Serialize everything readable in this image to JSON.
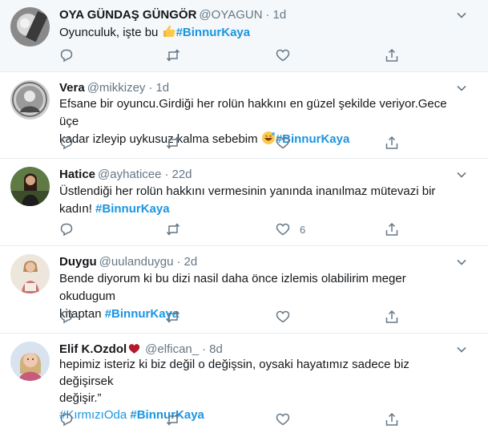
{
  "colors": {
    "accent": "#1b95e0",
    "muted": "#657786",
    "divider": "#e6ecf0",
    "highlight_bg": "#f5f8fa",
    "heart": "#b31b2b"
  },
  "tweets": [
    {
      "name": "OYA GÜNDAŞ GÜNGÖR",
      "handle": "@OYAGUN",
      "sep": "·",
      "time": "1d",
      "text_plain": "Oyunculuk, işte bu",
      "emoji": "thumbs-up-emoji",
      "hashtag": "#BinnurKaya",
      "like_count": ""
    },
    {
      "name": "Vera",
      "handle": "@mikkizey",
      "sep": "·",
      "time": "1d",
      "line1": "Efsane bir oyuncu.Girdiği her rolün hakkını en  güzel şekilde veriyor.Gece üçe",
      "line2": "kadar izleyip uykusuz kalma sebebim",
      "emoji": "grinning-sweat-emoji",
      "hashtag": "#BinnurKaya",
      "like_count": ""
    },
    {
      "name": "Hatice",
      "handle": "@ayhaticee",
      "sep": "·",
      "time": "22d",
      "line1": "Üstlendiği her rolün hakkını vermesinin yanında inanılmaz mütevazi bir",
      "line2": "kadın!",
      "hashtag": "#BinnurKaya",
      "like_count": "6"
    },
    {
      "name": "Duygu",
      "handle": "@uulanduygu",
      "sep": "·",
      "time": "2d",
      "line1": "Bende diyorum ki bu dizi nasil daha önce izlemis olabilirim meger okudugum",
      "line2": "kitaptan",
      "hashtag": "#BinnurKaya",
      "like_count": ""
    },
    {
      "name": "Elif K.Ozdol",
      "handle": "@elfican_",
      "sep": "·",
      "time": "8d",
      "line1": "hepimiz isteriz ki biz değil o değişsin, oysaki hayatımız sadece biz değişirsek",
      "line2": "değişir.”",
      "hashtag1": "#KırmızıOda",
      "hashtag": "#BinnurKaya",
      "like_count": ""
    }
  ]
}
